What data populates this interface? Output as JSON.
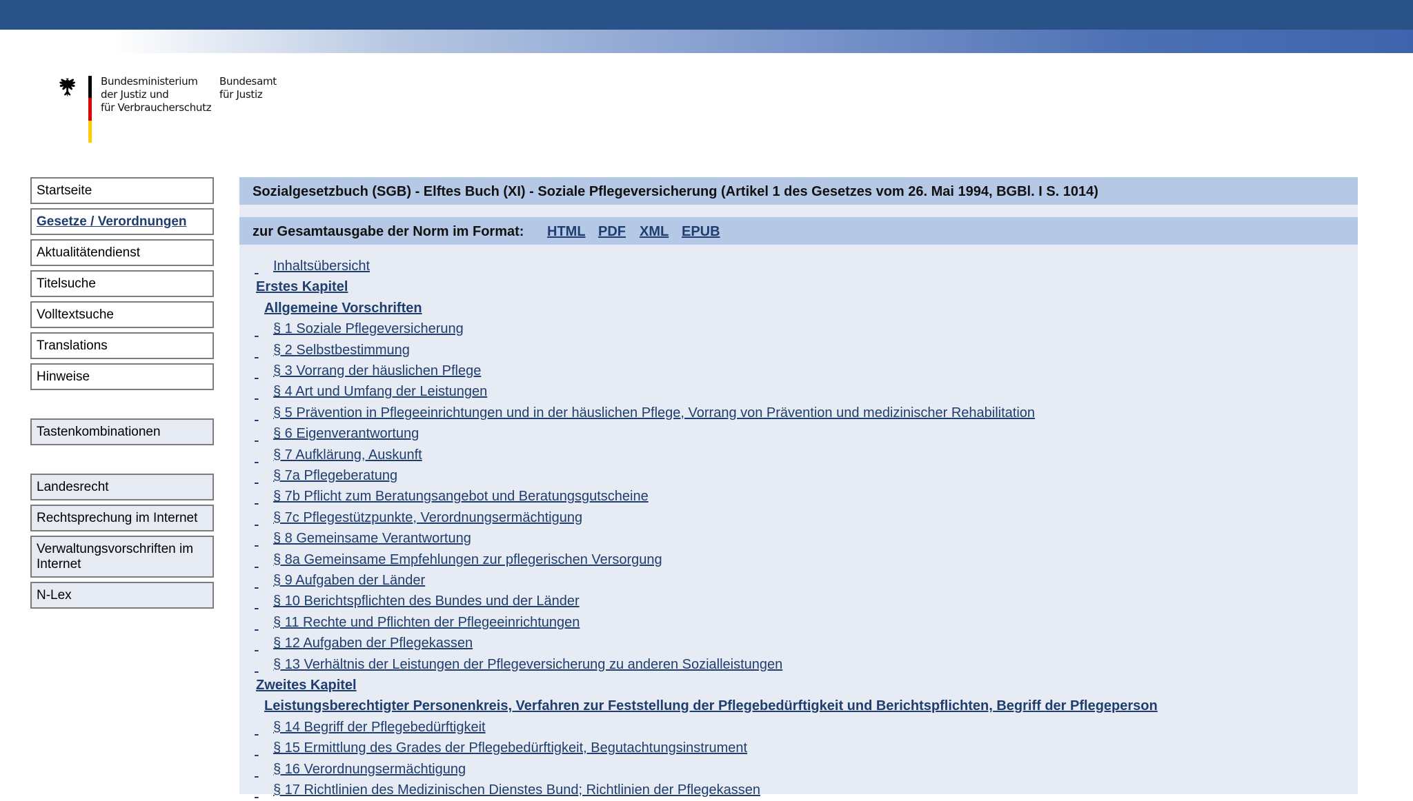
{
  "logo": {
    "ministry_lines": [
      "Bundesministerium",
      "der Justiz und",
      "für Verbraucherschutz"
    ],
    "office_lines": [
      "Bundesamt",
      "für Justiz"
    ]
  },
  "colors": {
    "topbar": "#285288",
    "title_bg": "#b5c9e6",
    "content_bg": "#e7ecf4",
    "link": "#1f3d6e"
  },
  "nav": {
    "group1": [
      {
        "label": "Startseite",
        "active": false
      },
      {
        "label": "Gesetze / Verordnungen",
        "active": true
      },
      {
        "label": "Aktualitätendienst",
        "active": false
      },
      {
        "label": "Titelsuche",
        "active": false
      },
      {
        "label": "Volltextsuche",
        "active": false
      },
      {
        "label": "Translations",
        "active": false
      },
      {
        "label": "Hinweise",
        "active": false
      }
    ],
    "group2": [
      {
        "label": "Tastenkombinationen"
      }
    ],
    "group3": [
      {
        "label": "Landesrecht"
      },
      {
        "label": "Rechtsprechung im Internet"
      },
      {
        "label": "Verwaltungsvorschriften im Internet"
      },
      {
        "label": "N-Lex"
      }
    ]
  },
  "main": {
    "title": "Sozialgesetzbuch (SGB) - Elftes Buch (XI) - Soziale Pflegeversicherung (Artikel 1 des Gesetzes vom 26. Mai 1994, BGBl. I S. 1014)",
    "format_label": "zur Gesamtausgabe der Norm im Format:",
    "formats": [
      "HTML",
      "PDF",
      "XML",
      "EPUB"
    ],
    "toc": [
      {
        "type": "item",
        "text": "Inhaltsübersicht"
      },
      {
        "type": "chapter",
        "text": "Erstes Kapitel"
      },
      {
        "type": "section",
        "text": "Allgemeine Vorschriften"
      },
      {
        "type": "item",
        "text": "§ 1 Soziale Pflegeversicherung"
      },
      {
        "type": "item",
        "text": "§ 2 Selbstbestimmung"
      },
      {
        "type": "item",
        "text": "§ 3 Vorrang der häuslichen Pflege"
      },
      {
        "type": "item",
        "text": "§ 4 Art und Umfang der Leistungen"
      },
      {
        "type": "item",
        "text": "§ 5 Prävention in Pflegeeinrichtungen und in der häuslichen Pflege, Vorrang von Prävention und medizinischer Rehabilitation"
      },
      {
        "type": "item",
        "text": "§ 6 Eigenverantwortung"
      },
      {
        "type": "item",
        "text": "§ 7 Aufklärung, Auskunft"
      },
      {
        "type": "item",
        "text": "§ 7a Pflegeberatung"
      },
      {
        "type": "item",
        "text": "§ 7b Pflicht zum Beratungsangebot und Beratungsgutscheine"
      },
      {
        "type": "item",
        "text": "§ 7c Pflegestützpunkte, Verordnungsermächtigung"
      },
      {
        "type": "item",
        "text": "§ 8 Gemeinsame Verantwortung"
      },
      {
        "type": "item",
        "text": "§ 8a Gemeinsame Empfehlungen zur pflegerischen Versorgung"
      },
      {
        "type": "item",
        "text": "§ 9 Aufgaben der Länder"
      },
      {
        "type": "item",
        "text": "§ 10 Berichtspflichten des Bundes und der Länder"
      },
      {
        "type": "item",
        "text": "§ 11 Rechte und Pflichten der Pflegeeinrichtungen"
      },
      {
        "type": "item",
        "text": "§ 12 Aufgaben der Pflegekassen"
      },
      {
        "type": "item",
        "text": "§ 13 Verhältnis der Leistungen der Pflegeversicherung zu anderen Sozialleistungen"
      },
      {
        "type": "chapter",
        "text": "Zweites Kapitel"
      },
      {
        "type": "section",
        "text": "Leistungsberechtigter Personenkreis, Verfahren zur Feststellung der Pflegebedürftigkeit und Berichtspflichten, Begriff der Pflegeperson"
      },
      {
        "type": "item",
        "text": "§ 14 Begriff der Pflegebedürftigkeit"
      },
      {
        "type": "item",
        "text": "§ 15 Ermittlung des Grades der Pflegebedürftigkeit, Begutachtungsinstrument"
      },
      {
        "type": "item",
        "text": "§ 16 Verordnungsermächtigung"
      },
      {
        "type": "item",
        "text": "§ 17 Richtlinien des Medizinischen Dienstes Bund; Richtlinien der Pflegekassen"
      }
    ]
  }
}
